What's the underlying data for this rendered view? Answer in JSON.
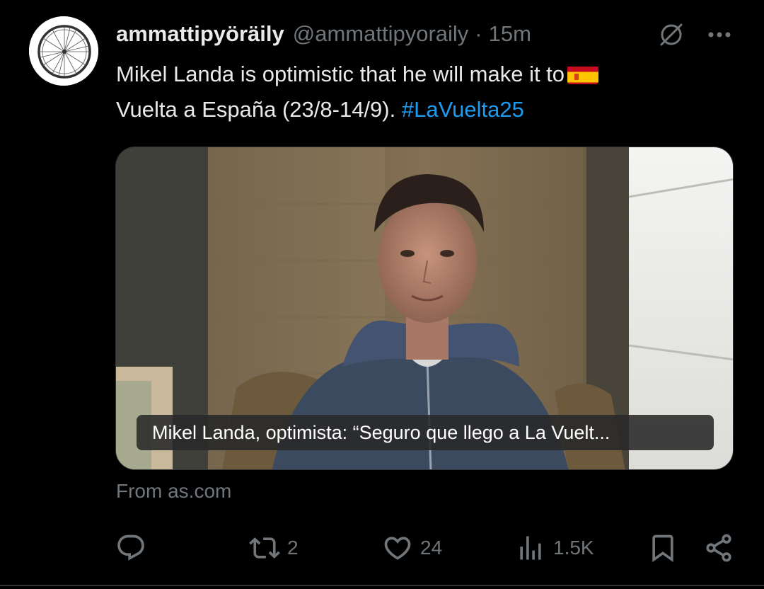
{
  "tweet": {
    "display_name": "ammattipyöräily",
    "handle": "@ammattipyoraily",
    "separator": "·",
    "time": "15m",
    "text_line1": "Mikel Landa is optimistic that he will make it to",
    "text_line2": "Vuelta a España (23/8-14/9).",
    "hashtag": "#LaVuelta25",
    "flag_icon": "spain-flag-emoji",
    "link_card": {
      "caption": "Mikel Landa, optimista: “Seguro que llego a La Vuelt...",
      "source": "From as.com"
    },
    "actions": {
      "reply_count": "",
      "retweet_count": "2",
      "like_count": "24",
      "views_count": "1.5K"
    }
  },
  "icons": {
    "avatar": "bicycle-wheel-avatar",
    "grok": "grok-icon",
    "more": "more-icon",
    "reply": "reply-icon",
    "retweet": "retweet-icon",
    "like": "heart-icon",
    "views": "views-icon",
    "bookmark": "bookmark-icon",
    "share": "share-icon"
  },
  "colors": {
    "background": "#000000",
    "primary_text": "#e7e9ea",
    "secondary_text": "#71767b",
    "link": "#1d9bf0"
  }
}
